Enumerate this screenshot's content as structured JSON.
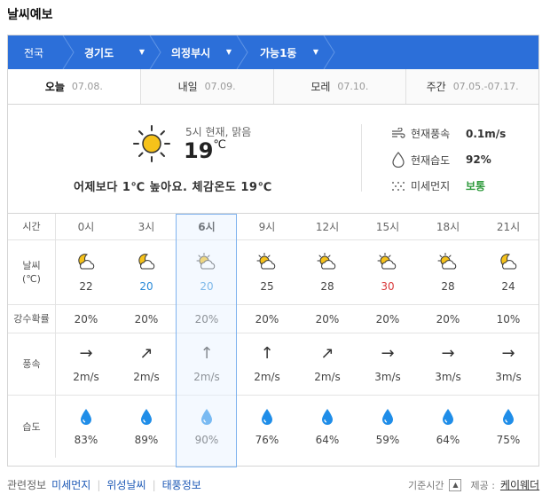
{
  "title": "날씨예보",
  "breadcrumb": {
    "items": [
      {
        "label": "전국"
      },
      {
        "label": "경기도"
      },
      {
        "label": "의정부시"
      },
      {
        "label": "가능1동"
      }
    ]
  },
  "tabs": [
    {
      "label": "오늘",
      "date": "07.08."
    },
    {
      "label": "내일",
      "date": "07.09."
    },
    {
      "label": "모레",
      "date": "07.10."
    },
    {
      "label": "주간",
      "date": "07.05.-07.17."
    }
  ],
  "current": {
    "desc": "5시 현재, 맑음",
    "temp": "19",
    "unit": "℃",
    "compare": "어제보다 1℃ 높아요.  체감온도 19℃",
    "icon": "sun-icon",
    "wind_label": "현재풍속",
    "wind_value": "0.1m/s",
    "humidity_label": "현재습도",
    "humidity_value": "92%",
    "dust_label": "미세먼지",
    "dust_value": "보통",
    "dust_color": "#2d9a3b"
  },
  "hourly": {
    "labels": {
      "time": "시간",
      "weather": "날씨",
      "weather_unit": "(℃)",
      "rain": "강수확률",
      "wind": "풍속",
      "humidity": "습도"
    },
    "times": [
      "0시",
      "3시",
      "6시",
      "9시",
      "12시",
      "15시",
      "18시",
      "21시"
    ],
    "icons": [
      "moon-cloud-icon",
      "moon-cloud-icon",
      "sun-cloud-icon",
      "sun-cloud-icon",
      "sun-cloud-icon",
      "sun-cloud-icon",
      "sun-cloud-icon",
      "moon-cloud-icon"
    ],
    "temps": [
      "22",
      "20",
      "20",
      "25",
      "28",
      "30",
      "28",
      "24"
    ],
    "rain": [
      "20%",
      "20%",
      "20%",
      "20%",
      "20%",
      "20%",
      "20%",
      "10%"
    ],
    "wind_dirs": [
      "→",
      "↗",
      "↑",
      "↑",
      "↗",
      "→",
      "→",
      "→"
    ],
    "wind_speeds": [
      "2m/s",
      "2m/s",
      "2m/s",
      "2m/s",
      "2m/s",
      "3m/s",
      "3m/s",
      "3m/s"
    ],
    "humidity": [
      "83%",
      "89%",
      "90%",
      "76%",
      "64%",
      "59%",
      "64%",
      "75%"
    ],
    "selected": "6시"
  },
  "footer": {
    "related": "관련정보",
    "links": [
      "미세먼지",
      "위성날씨",
      "태풍정보"
    ],
    "base_time": "기준시간",
    "provider_label": "제공 :",
    "provider": "케이웨더"
  }
}
